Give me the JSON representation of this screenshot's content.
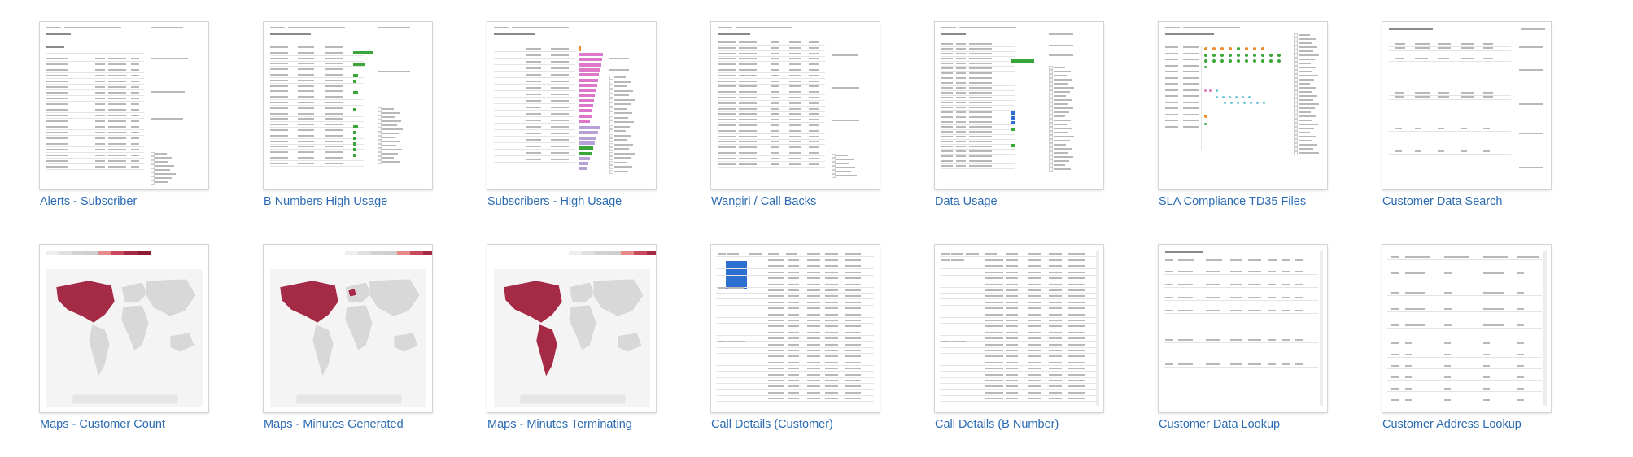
{
  "colors": {
    "link": "#2a6bb3",
    "green": "#3aa639",
    "pink": "#dd77c9",
    "purple": "#b89fd6",
    "orange": "#f08a24",
    "blue": "#2d6fd0",
    "teal": "#6fc3d9",
    "map_red": "#a42a45"
  },
  "tiles": [
    {
      "title": "Alerts - Subscriber"
    },
    {
      "title": "B Numbers High Usage"
    },
    {
      "title": "Subscribers - High Usage"
    },
    {
      "title": "Wangiri / Call Backs"
    },
    {
      "title": "Data Usage"
    },
    {
      "title": "SLA Compliance TD35 Files"
    },
    {
      "title": "Customer Data Search"
    },
    {
      "title": "Maps - Customer Count"
    },
    {
      "title": "Maps - Minutes Generated"
    },
    {
      "title": "Maps - Minutes Terminating"
    },
    {
      "title": "Call Details (Customer)"
    },
    {
      "title": "Call Details (B Number)"
    },
    {
      "title": "Customer Data Lookup"
    },
    {
      "title": "Customer Address Lookup"
    }
  ]
}
